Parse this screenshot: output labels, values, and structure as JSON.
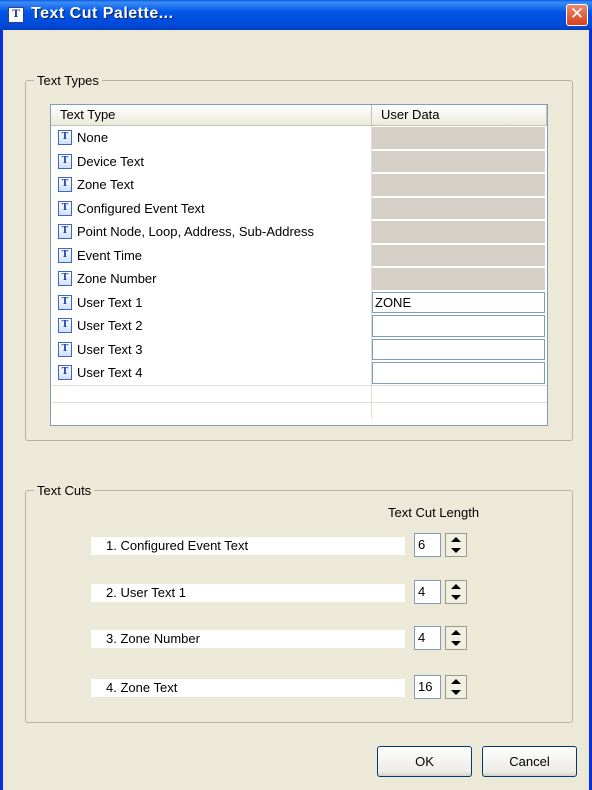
{
  "window": {
    "title": "Text Cut Palette...",
    "title_icon": "text-palette-icon",
    "close_glyph": "✕"
  },
  "text_types": {
    "legend": "Text Types",
    "columns": [
      "Text Type",
      "User Data"
    ],
    "rows": [
      {
        "label": "None",
        "user_data": null,
        "editable": false
      },
      {
        "label": "Device Text",
        "user_data": null,
        "editable": false
      },
      {
        "label": "Zone Text",
        "user_data": null,
        "editable": false
      },
      {
        "label": "Configured Event Text",
        "user_data": null,
        "editable": false
      },
      {
        "label": "Point Node, Loop, Address, Sub-Address",
        "user_data": null,
        "editable": false
      },
      {
        "label": "Event Time",
        "user_data": null,
        "editable": false
      },
      {
        "label": "Zone Number",
        "user_data": null,
        "editable": false
      },
      {
        "label": "User Text 1",
        "user_data": "ZONE",
        "editable": true
      },
      {
        "label": "User Text 2",
        "user_data": "",
        "editable": true
      },
      {
        "label": "User Text 3",
        "user_data": "",
        "editable": true
      },
      {
        "label": "User Text 4",
        "user_data": "",
        "editable": true
      }
    ],
    "row_icon": "text-type-icon",
    "row_icon_glyph": "T"
  },
  "text_cuts": {
    "legend": "Text Cuts",
    "length_header": "Text Cut Length",
    "items": [
      {
        "label": "1.  Configured Event Text",
        "length": "6"
      },
      {
        "label": "2.  User Text 1",
        "length": "4"
      },
      {
        "label": "3.  Zone Number",
        "length": "4"
      },
      {
        "label": "4.  Zone Text",
        "length": "16"
      }
    ]
  },
  "buttons": {
    "ok": "OK",
    "cancel": "Cancel"
  }
}
